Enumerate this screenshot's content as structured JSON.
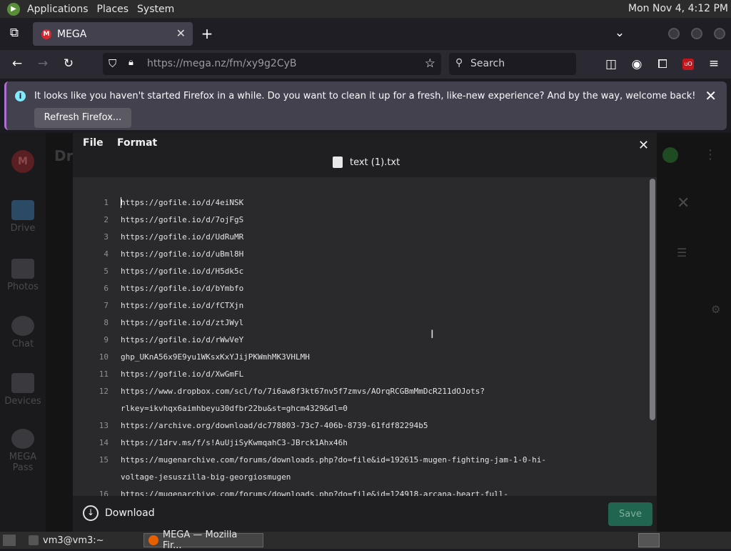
{
  "top_panel": {
    "applications": "Applications",
    "places": "Places",
    "system": "System",
    "clock": "Mon Nov  4,  4:12 PM"
  },
  "browser": {
    "tab_title": "MEGA",
    "url": "https://mega.nz/fm/xy9g2CyB",
    "search_placeholder": "Search",
    "tab_favicon_letter": "M",
    "extension_badge": "uO"
  },
  "notification": {
    "message": "It looks like you haven't started Firefox in a while. Do you want to clean it up for a fresh, like-new experience? And by the way, welcome back!",
    "button": "Refresh Firefox..."
  },
  "mega_page": {
    "header_partial": "Dri",
    "avatar_letter": "M",
    "sidebar": [
      {
        "label": "Drive"
      },
      {
        "label": "Photos"
      },
      {
        "label": "Chat"
      },
      {
        "label": "Devices"
      },
      {
        "label": "MEGA Pass"
      }
    ]
  },
  "editor": {
    "menu_file": "File",
    "menu_format": "Format",
    "file_name": "text (1).txt",
    "download_label": "Download",
    "save_label": "Save",
    "lines": [
      {
        "n": "1",
        "text": "https://gofile.io/d/4eiNSK"
      },
      {
        "n": "2",
        "text": "https://gofile.io/d/7ojFgS"
      },
      {
        "n": "3",
        "text": "https://gofile.io/d/UdRuMR"
      },
      {
        "n": "4",
        "text": "https://gofile.io/d/uBml8H"
      },
      {
        "n": "5",
        "text": "https://gofile.io/d/H5dk5c"
      },
      {
        "n": "6",
        "text": "https://gofile.io/d/bYmbfo"
      },
      {
        "n": "7",
        "text": "https://gofile.io/d/fCTXjn"
      },
      {
        "n": "8",
        "text": "https://gofile.io/d/ztJWyl"
      },
      {
        "n": "9",
        "text": "https://gofile.io/d/rWwVeY"
      },
      {
        "n": "10",
        "text": "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"
      },
      {
        "n": "11",
        "text": "https://gofile.io/d/XwGmFL"
      },
      {
        "n": "12",
        "text": "https://www.dropbox.com/scl/fo/7i6aw8f3kt67nv5f7zmvs/AOrqRCGBmMmDcR211dOJots?"
      },
      {
        "n": "",
        "text": "rlkey=ikvhqx6aimhbeyu30dfbr22bu&st=ghcm4329&dl=0"
      },
      {
        "n": "13",
        "text": "https://archive.org/download/dc778803-73c7-406b-8739-61fdf82294b5"
      },
      {
        "n": "14",
        "text": "https://1drv.ms/f/s!AuUjiSyKwmqahC3-JBrck1Ahx46h"
      },
      {
        "n": "15",
        "text": "https://mugenarchive.com/forums/downloads.php?do=file&id=192615-mugen-fighting-jam-1-0-hi-"
      },
      {
        "n": "",
        "text": "voltage-jesuszilla-big-georgiosmugen"
      },
      {
        "n": "16",
        "text": "https://mugenarchive.com/forums/downloads.php?do=file&id=124918-arcana-heart-full-"
      }
    ]
  },
  "taskbar": {
    "terminal": "vm3@vm3:~",
    "firefox": "MEGA — Mozilla Fir..."
  }
}
